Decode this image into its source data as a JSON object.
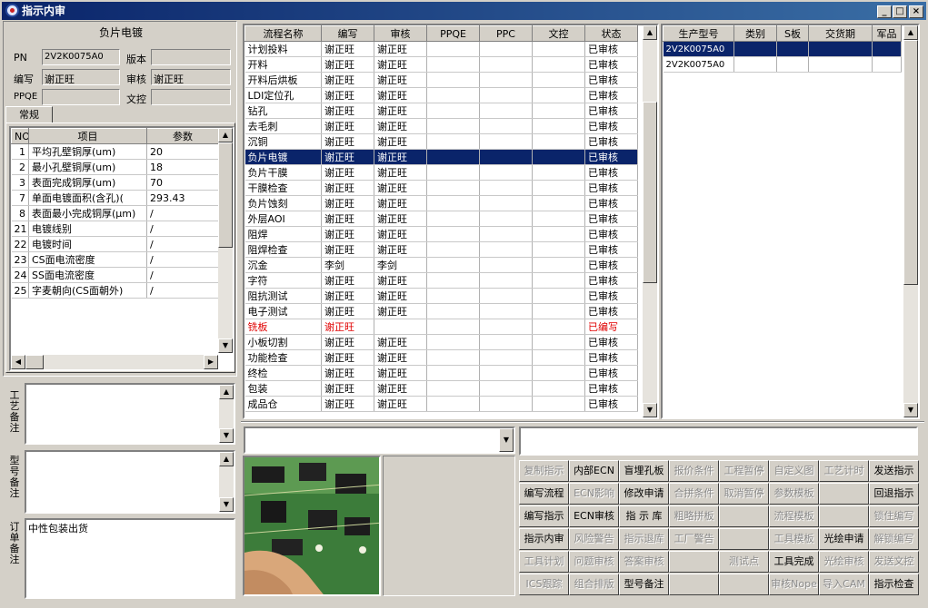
{
  "window": {
    "title": "指示内审"
  },
  "left": {
    "process_name": "负片电镀",
    "pn_label": "PN",
    "pn_value": "2V2K0075A0",
    "version_label": "版本",
    "version_value": "",
    "author_label": "编写",
    "author_value": "谢正旺",
    "review_label": "审核",
    "review_value": "谢正旺",
    "ppqe_label": "PPQE",
    "ppqe_value": "",
    "doc_control_label": "文控",
    "doc_control_value": "",
    "tab_label": "常规",
    "params_headers": [
      "NO",
      "项目",
      "参数"
    ],
    "params_rows": [
      {
        "no": "1",
        "item": "平均孔壁铜厚(um)",
        "param": "20"
      },
      {
        "no": "2",
        "item": "最小孔壁铜厚(um)",
        "param": "18"
      },
      {
        "no": "3",
        "item": "表面完成铜厚(um)",
        "param": "70"
      },
      {
        "no": "7",
        "item": "单面电镀面积(含孔)(",
        "param": "293.43"
      },
      {
        "no": "8",
        "item": "表面最小完成铜厚(μm)",
        "param": "/"
      },
      {
        "no": "21",
        "item": "电镀线别",
        "param": "/"
      },
      {
        "no": "22",
        "item": "电镀时间",
        "param": "/"
      },
      {
        "no": "23",
        "item": "CS面电流密度",
        "param": "/"
      },
      {
        "no": "24",
        "item": "SS面电流密度",
        "param": "/"
      },
      {
        "no": "25",
        "item": "字麦朝向(CS面朝外)",
        "param": "/"
      }
    ],
    "craft_note_label": "工艺备注",
    "model_note_label": "型号备注",
    "order_note_label": "订单备注",
    "order_note_text": "中性包装出货"
  },
  "process": {
    "headers": [
      "流程名称",
      "编写",
      "审核",
      "PPQE",
      "PPC",
      "文控",
      "状态"
    ],
    "rows": [
      {
        "name": "计划投料",
        "author": "谢正旺",
        "reviewer": "谢正旺",
        "status": "已审核"
      },
      {
        "name": "开料",
        "author": "谢正旺",
        "reviewer": "谢正旺",
        "status": "已审核"
      },
      {
        "name": "开料后烘板",
        "author": "谢正旺",
        "reviewer": "谢正旺",
        "status": "已审核"
      },
      {
        "name": "LDI定位孔",
        "author": "谢正旺",
        "reviewer": "谢正旺",
        "status": "已审核"
      },
      {
        "name": "钻孔",
        "author": "谢正旺",
        "reviewer": "谢正旺",
        "status": "已审核"
      },
      {
        "name": "去毛刺",
        "author": "谢正旺",
        "reviewer": "谢正旺",
        "status": "已审核"
      },
      {
        "name": "沉铜",
        "author": "谢正旺",
        "reviewer": "谢正旺",
        "status": "已审核"
      },
      {
        "name": "负片电镀",
        "author": "谢正旺",
        "reviewer": "谢正旺",
        "status": "已审核",
        "selected": true
      },
      {
        "name": "负片干膜",
        "author": "谢正旺",
        "reviewer": "谢正旺",
        "status": "已审核"
      },
      {
        "name": "干膜检查",
        "author": "谢正旺",
        "reviewer": "谢正旺",
        "status": "已审核"
      },
      {
        "name": "负片蚀刻",
        "author": "谢正旺",
        "reviewer": "谢正旺",
        "status": "已审核"
      },
      {
        "name": "外层AOI",
        "author": "谢正旺",
        "reviewer": "谢正旺",
        "status": "已审核"
      },
      {
        "name": "阻焊",
        "author": "谢正旺",
        "reviewer": "谢正旺",
        "status": "已审核"
      },
      {
        "name": "阻焊检查",
        "author": "谢正旺",
        "reviewer": "谢正旺",
        "status": "已审核"
      },
      {
        "name": "沉金",
        "author": "李剑",
        "reviewer": "李剑",
        "status": "已审核"
      },
      {
        "name": "字符",
        "author": "谢正旺",
        "reviewer": "谢正旺",
        "status": "已审核"
      },
      {
        "name": "阻抗测试",
        "author": "谢正旺",
        "reviewer": "谢正旺",
        "status": "已审核"
      },
      {
        "name": "电子测试",
        "author": "谢正旺",
        "reviewer": "谢正旺",
        "status": "已审核"
      },
      {
        "name": "铣板",
        "author": "谢正旺",
        "reviewer": "",
        "status": "已编写",
        "red": true
      },
      {
        "name": "小板切割",
        "author": "谢正旺",
        "reviewer": "谢正旺",
        "status": "已审核"
      },
      {
        "name": "功能检查",
        "author": "谢正旺",
        "reviewer": "谢正旺",
        "status": "已审核"
      },
      {
        "name": "终检",
        "author": "谢正旺",
        "reviewer": "谢正旺",
        "status": "已审核"
      },
      {
        "name": "包装",
        "author": "谢正旺",
        "reviewer": "谢正旺",
        "status": "已审核"
      },
      {
        "name": "成品仓",
        "author": "谢正旺",
        "reviewer": "谢正旺",
        "status": "已审核"
      }
    ]
  },
  "models": {
    "headers": [
      "生产型号",
      "类别",
      "S板",
      "交货期",
      "军品"
    ],
    "rows": [
      {
        "model": "2V2K0075A0",
        "selected": true
      },
      {
        "model": "2V2K0075A0",
        "selected": false
      }
    ]
  },
  "buttons": [
    [
      {
        "label": "复制指示",
        "enabled": false
      },
      {
        "label": "内部ECN",
        "enabled": true
      },
      {
        "label": "盲埋孔板",
        "enabled": true
      },
      {
        "label": "报价条件",
        "enabled": false
      },
      {
        "label": "工程暂停",
        "enabled": false
      },
      {
        "label": "自定义图",
        "enabled": false
      },
      {
        "label": "工艺计时",
        "enabled": false
      },
      {
        "label": "发送指示",
        "enabled": true
      }
    ],
    [
      {
        "label": "编写流程",
        "enabled": true
      },
      {
        "label": "ECN影响",
        "enabled": false
      },
      {
        "label": "修改申请",
        "enabled": true
      },
      {
        "label": "合拼条件",
        "enabled": false
      },
      {
        "label": "取消暂停",
        "enabled": false
      },
      {
        "label": "参数模板",
        "enabled": false
      },
      {
        "label": "",
        "enabled": false
      },
      {
        "label": "回退指示",
        "enabled": true
      }
    ],
    [
      {
        "label": "编写指示",
        "enabled": true
      },
      {
        "label": "ECN审核",
        "enabled": true
      },
      {
        "label": "指 示 库",
        "enabled": true
      },
      {
        "label": "粗略拼板",
        "enabled": false
      },
      {
        "label": "",
        "enabled": false
      },
      {
        "label": "流程模板",
        "enabled": false
      },
      {
        "label": "",
        "enabled": false
      },
      {
        "label": "锁住编写",
        "enabled": false
      }
    ],
    [
      {
        "label": "指示内审",
        "enabled": true
      },
      {
        "label": "风险警告",
        "enabled": false
      },
      {
        "label": "指示退库",
        "enabled": false
      },
      {
        "label": "工厂警告",
        "enabled": false
      },
      {
        "label": "",
        "enabled": false
      },
      {
        "label": "工具模板",
        "enabled": false
      },
      {
        "label": "光绘申请",
        "enabled": true
      },
      {
        "label": "解锁编写",
        "enabled": false
      }
    ],
    [
      {
        "label": "工具计划",
        "enabled": false
      },
      {
        "label": "问题审核",
        "enabled": false
      },
      {
        "label": "答案审核",
        "enabled": false
      },
      {
        "label": "",
        "enabled": false
      },
      {
        "label": "测试点",
        "enabled": false
      },
      {
        "label": "工具完成",
        "enabled": true
      },
      {
        "label": "光绘审核",
        "enabled": false
      },
      {
        "label": "发送文控",
        "enabled": false
      }
    ],
    [
      {
        "label": "ICS跟踪",
        "enabled": false
      },
      {
        "label": "组合排版",
        "enabled": false
      },
      {
        "label": "型号备注",
        "enabled": true
      },
      {
        "label": "",
        "enabled": false
      },
      {
        "label": "",
        "enabled": false
      },
      {
        "label": "审核Nope",
        "enabled": false
      },
      {
        "label": "导入CAM",
        "enabled": false
      },
      {
        "label": "指示检查",
        "enabled": true
      }
    ]
  ]
}
